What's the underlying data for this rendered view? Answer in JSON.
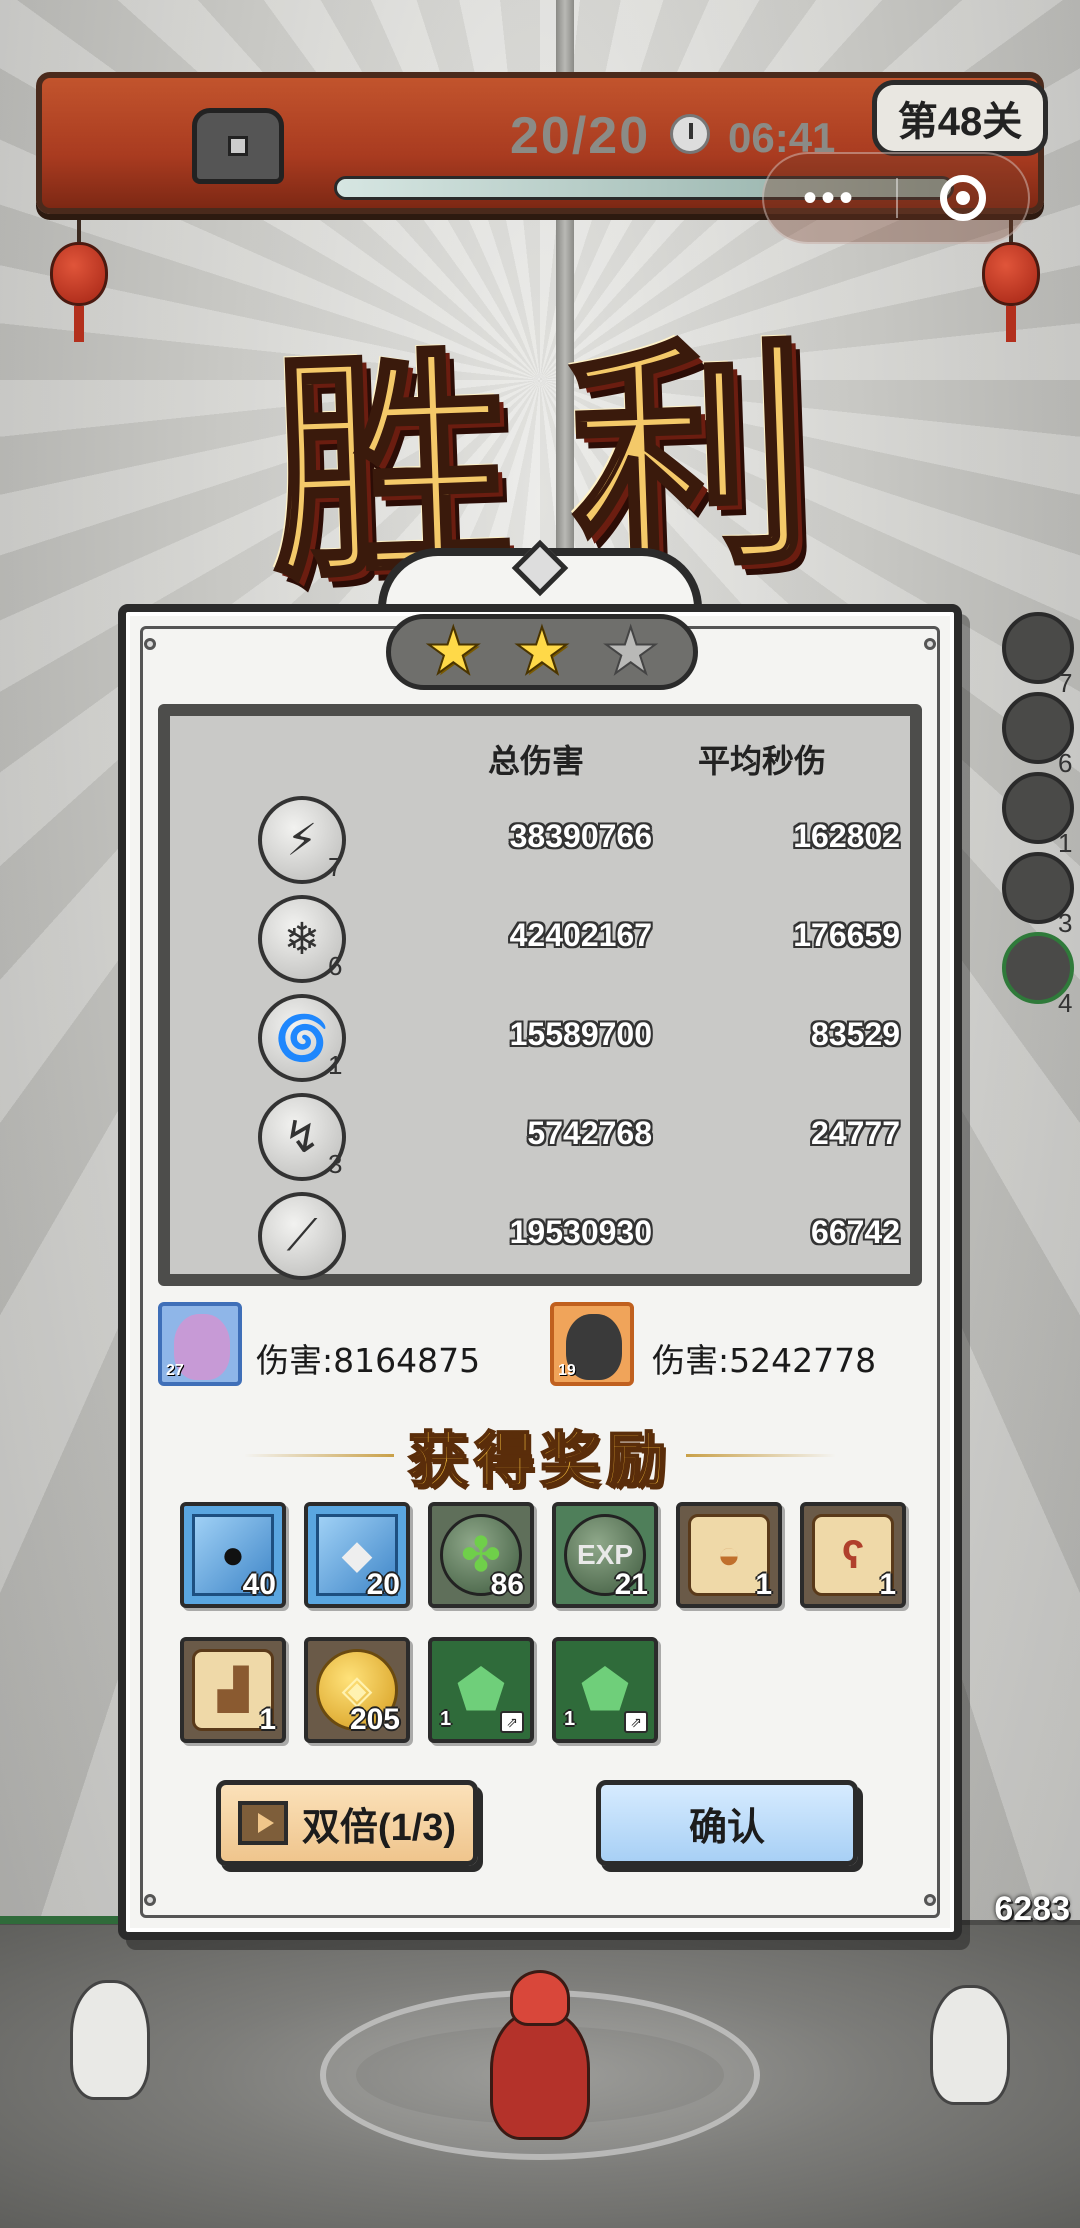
{
  "hud": {
    "wave_count": "20/20",
    "timer": "06:41",
    "level": "第48关",
    "progress": 1.0
  },
  "capsule": {
    "more": "•••"
  },
  "victory_title": "胜利",
  "stars": {
    "earned": 2,
    "total": 3
  },
  "stats": {
    "headers": {
      "total": "总伤害",
      "avg": "平均秒伤"
    },
    "rows": [
      {
        "icon": "lightning-skill-icon",
        "glyph": "⚡",
        "level": "7",
        "total": "38390766",
        "avg": "162802"
      },
      {
        "icon": "crystal-skill-icon",
        "glyph": "❄",
        "level": "6",
        "total": "42402167",
        "avg": "176659"
      },
      {
        "icon": "tornado-skill-icon",
        "glyph": "🌀",
        "level": "1",
        "total": "15589700",
        "avg": "83529"
      },
      {
        "icon": "zigzag-skill-icon",
        "glyph": "↯",
        "level": "3",
        "total": "5742768",
        "avg": "24777"
      },
      {
        "icon": "slash-skill-icon",
        "glyph": "⟋",
        "level": "",
        "total": "19530930",
        "avg": "66742"
      }
    ]
  },
  "heroes": [
    {
      "level": "27",
      "damage": "伤害:8164875",
      "border": "#3f6fb8",
      "face": "#c79ad6",
      "bg": "#8fb6e8"
    },
    {
      "level": "19",
      "damage": "伤害:5242778",
      "border": "#c0601f",
      "face": "#3a3a3a",
      "bg": "#f0a45a"
    }
  ],
  "rewards_title": "获得奖励",
  "rewards": [
    {
      "name": "bomb-item",
      "qty": "40",
      "bg": "#5aa6e0",
      "glyph": "●",
      "color": "#111"
    },
    {
      "name": "stone-item",
      "qty": "20",
      "bg": "#5aa6e0",
      "glyph": "◆",
      "color": "#eee"
    },
    {
      "name": "clover-emblem-item",
      "qty": "86",
      "bg": "#5f6f5a",
      "glyph": "✤",
      "color": "#6fcf4a"
    },
    {
      "name": "exp-orb-item",
      "qty": "21",
      "bg": "#4f7f5a",
      "glyph": "EXP",
      "color": "#e9e9e9"
    },
    {
      "name": "hat-scroll-item",
      "qty": "1",
      "bg": "#6a5a48",
      "glyph": "◒",
      "color": "#c0702c"
    },
    {
      "name": "staff-scroll-item",
      "qty": "1",
      "bg": "#6a5a48",
      "glyph": "ʕ",
      "color": "#b0402c"
    },
    {
      "name": "boot-scroll-item",
      "qty": "1",
      "bg": "#6a5a48",
      "glyph": "▟",
      "color": "#8a5a30"
    },
    {
      "name": "gold-coin-item",
      "qty": "205",
      "bg": "#6a5a48",
      "glyph": "◈",
      "color": "#e8b62c"
    },
    {
      "name": "green-gem-item",
      "qty": "1",
      "bg": "#2f6b3a",
      "glyph": "⬟",
      "color": "#6fcf7a"
    },
    {
      "name": "green-gem-item",
      "qty": "1",
      "bg": "#2f6b3a",
      "glyph": "⬟",
      "color": "#6fcf7a"
    }
  ],
  "buttons": {
    "double": "双倍(1/3)",
    "confirm": "确认"
  },
  "enemy_hp": "6283",
  "side_counts": [
    "7",
    "6",
    "1",
    "3",
    "4"
  ]
}
